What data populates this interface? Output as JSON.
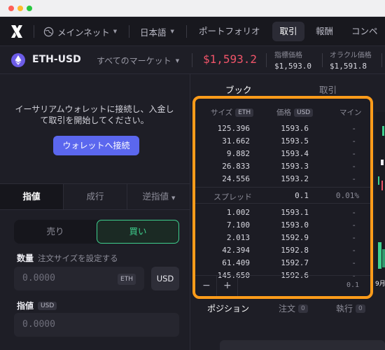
{
  "colors": {
    "accent": "#5b67ee",
    "buy": "#3fcf8e",
    "sell_price": "#f05469",
    "highlight": "#ff9c1a"
  },
  "nav": {
    "network": "メインネット",
    "language": "日本語",
    "links": [
      "ポートフォリオ",
      "取引",
      "報酬",
      "コンペ"
    ],
    "active": "取引"
  },
  "market": {
    "symbol": "ETH-USD",
    "all_markets": "すべてのマーケット",
    "price": "$1,593.2",
    "index_label": "指標価格",
    "index_value": "$1,593.0",
    "oracle_label": "オラクル価格",
    "oracle_value": "$1,591.8"
  },
  "left": {
    "connect_text": "イーサリアムウォレットに接続し、入金して取引を開始してください。",
    "connect_button": "ウォレットへ接続",
    "order_tabs": [
      "指値",
      "成行",
      "逆指値"
    ],
    "side_sell": "売り",
    "side_buy": "買い",
    "size_label": "数量",
    "size_hint": "注文サイズを設定する",
    "size_placeholder": "0.0000",
    "size_unit": "ETH",
    "usd_button": "USD",
    "limit_label": "指値",
    "limit_unit": "USD",
    "limit_placeholder": "0.0000"
  },
  "book": {
    "tab_book": "ブック",
    "tab_trades": "取引",
    "col_size": "サイズ",
    "col_size_unit": "ETH",
    "col_price": "価格",
    "col_price_unit": "USD",
    "col_mine": "マイン",
    "asks": [
      {
        "size": "125.396",
        "price": "1593.6",
        "mine": "-"
      },
      {
        "size": "31.662",
        "price": "1593.5",
        "mine": "-"
      },
      {
        "size": "9.882",
        "price": "1593.4",
        "mine": "-"
      },
      {
        "size": "26.833",
        "price": "1593.3",
        "mine": "-"
      },
      {
        "size": "24.556",
        "price": "1593.2",
        "mine": "-"
      }
    ],
    "spread_label": "スプレッド",
    "spread_value": "0.1",
    "spread_pct": "0.01%",
    "bids": [
      {
        "size": "1.002",
        "price": "1593.1",
        "mine": "-"
      },
      {
        "size": "7.100",
        "price": "1593.0",
        "mine": "-"
      },
      {
        "size": "2.013",
        "price": "1592.9",
        "mine": "-"
      },
      {
        "size": "42.394",
        "price": "1592.8",
        "mine": "-"
      },
      {
        "size": "61.409",
        "price": "1592.7",
        "mine": "-"
      },
      {
        "size": "145.650",
        "price": "1592.6",
        "mine": "-"
      }
    ],
    "minus": "−",
    "plus": "+",
    "grouping": "0.1"
  },
  "bottom_tabs": [
    {
      "label": "ポジション",
      "count": ""
    },
    {
      "label": "注文",
      "count": "0"
    },
    {
      "label": "執行",
      "count": "0"
    }
  ],
  "chart_strip_labels": [
    "9月"
  ]
}
